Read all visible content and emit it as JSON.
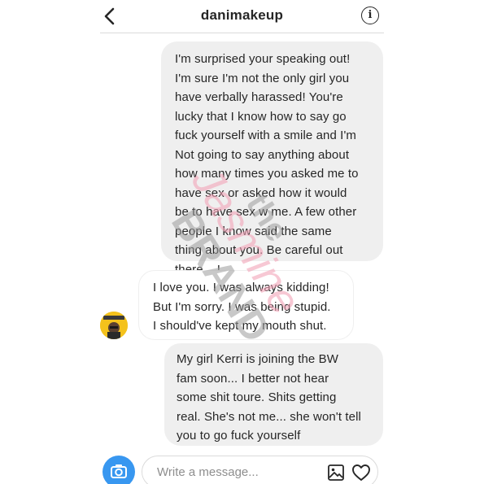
{
  "header": {
    "title": "danimakeup",
    "back_icon": "chevron-left-icon",
    "info_icon": "info-icon",
    "info_glyph": "i"
  },
  "messages": [
    {
      "direction": "outgoing",
      "text": "I'm surprised your speaking out!\nI'm sure I'm not the only girl you\nhave verbally harassed! You're\nlucky that I know how to say go\nfuck yourself with a smile and I'm\nNot going to say anything about\nhow many times you asked me to\nhave sex or asked how it would\nbe to have sex w me. A few other\npeople I know said the same\nthing about you. Be careful out\nthere....!"
    },
    {
      "direction": "incoming",
      "text": "I love you. I was always kidding!\nBut I'm sorry. I was being stupid.\nI should've kept my mouth shut."
    },
    {
      "direction": "outgoing",
      "text": "My girl Kerri is joining the BW\nfam soon... I better not hear\nsome shit toure. Shits getting\nreal. She's not me... she won't tell\nyou to go fuck yourself"
    }
  ],
  "composer": {
    "placeholder": "Write a message...",
    "camera_icon": "camera-icon",
    "gallery_icon": "image-icon",
    "heart_icon": "heart-icon"
  },
  "watermark": {
    "line1": "the",
    "line2": "Jasmine",
    "line3": "BRAND"
  },
  "colors": {
    "accent": "#3897f0",
    "outgoing_bubble": "#efefef",
    "text": "#262626",
    "placeholder": "#8e8e8e",
    "avatar_bg": "#f4c21c",
    "watermark_pink": "#f2a4b8",
    "watermark_gray": "#9a9a9a"
  }
}
